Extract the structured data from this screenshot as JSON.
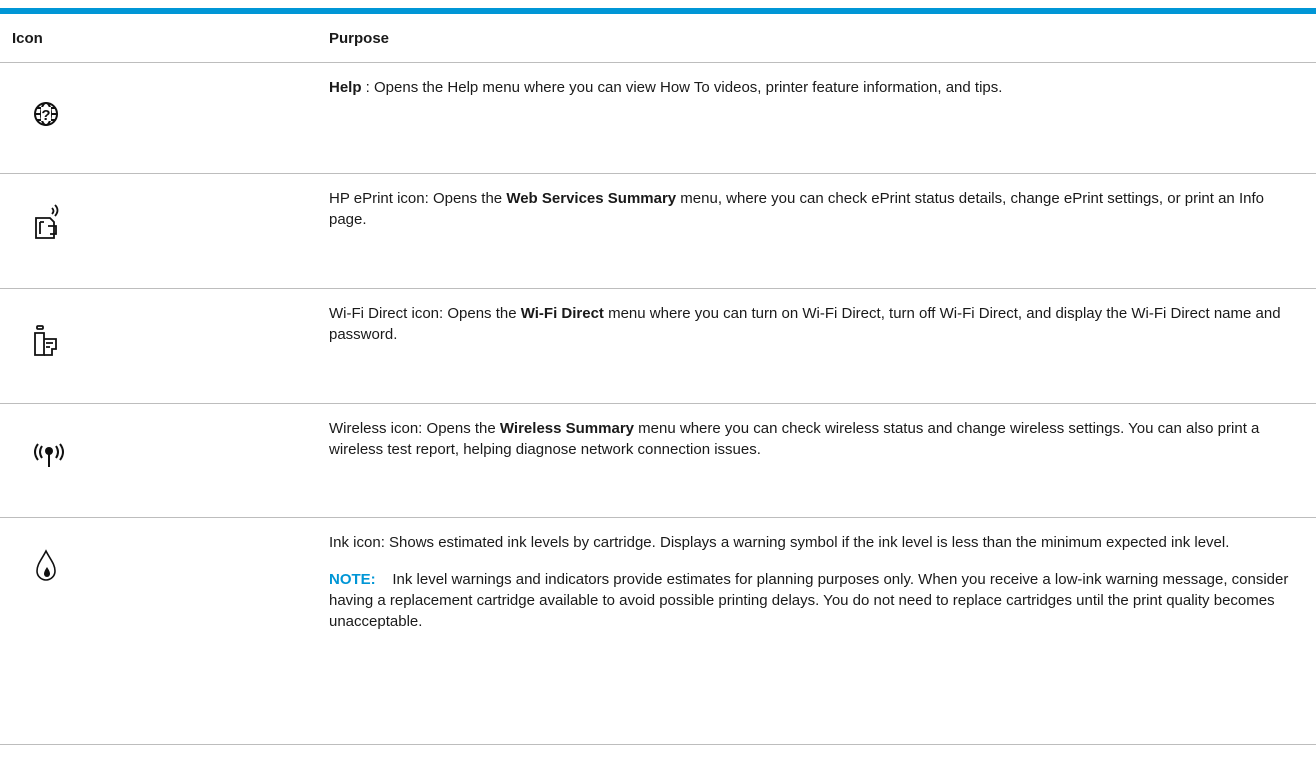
{
  "header": {
    "col_icon": "Icon",
    "col_purpose": "Purpose"
  },
  "rows": [
    {
      "icon": "help-globe-icon",
      "bold": "Help",
      "before": "",
      "after": " : Opens the Help menu where you can view How To videos, printer feature information, and tips."
    },
    {
      "icon": "eprint-icon",
      "before": "HP ePrint icon: Opens the ",
      "bold": "Web Services Summary",
      "after": " menu, where you can check ePrint status details, change ePrint settings, or print an Info page."
    },
    {
      "icon": "wifi-direct-icon",
      "before": "Wi-Fi Direct icon: Opens the ",
      "bold": "Wi-Fi Direct",
      "after": " menu where you can turn on Wi-Fi Direct, turn off Wi-Fi Direct, and display the Wi-Fi Direct name and password."
    },
    {
      "icon": "wireless-icon",
      "before": "Wireless icon: Opens the ",
      "bold": "Wireless Summary",
      "after": " menu where you can check wireless status and change wireless settings. You can also print a wireless test report, helping diagnose network connection issues."
    },
    {
      "icon": "ink-drop-icon",
      "text": "Ink icon: Shows estimated ink levels by cartridge. Displays a warning symbol if the ink level is less than the minimum expected ink level.",
      "note_label": "NOTE:",
      "note_text": "Ink level warnings and indicators provide estimates for planning purposes only. When you receive a low-ink warning message, consider having a replacement cartridge available to avoid possible printing delays. You do not need to replace cartridges until the print quality becomes unacceptable."
    }
  ],
  "colors": {
    "accent": "#0096d6",
    "text": "#1a1a1a",
    "rule": "#bdbdbd"
  }
}
